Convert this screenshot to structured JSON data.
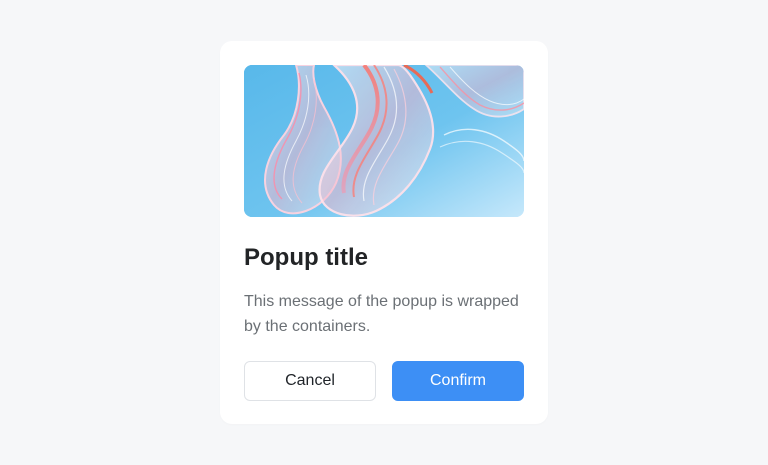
{
  "popup": {
    "title": "Popup title",
    "message": "This message of the popup is wrapped by the containers.",
    "image_description": "abstract-glass-waves",
    "cancel_label": "Cancel",
    "confirm_label": "Confirm"
  },
  "colors": {
    "background": "#f6f7f9",
    "card": "#ffffff",
    "title": "#222426",
    "message": "#6b7075",
    "confirm": "#3d8ff5",
    "cancel_border": "#dfe2e6"
  }
}
